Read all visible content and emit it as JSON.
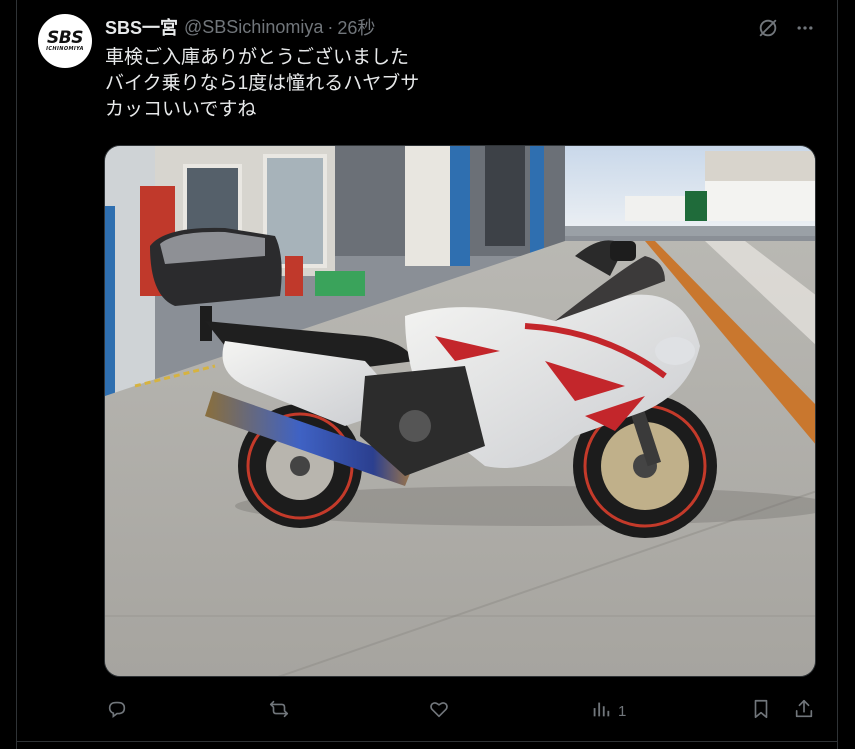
{
  "author": {
    "display_name": "SBS一宮",
    "handle": "@SBSichinomiya",
    "separator": "·",
    "timestamp": "26秒",
    "avatar_logo": "SBS",
    "avatar_logo_sub": "ICHINOMIYA"
  },
  "tweet": {
    "lines": [
      "車検ご入庫ありがとうございました",
      "バイク乗りなら1度は憧れるハヤブサ",
      "カッコいいですね"
    ]
  },
  "media": {
    "alt": "white and red sport motorcycle parked in an inspection garage"
  },
  "actions": {
    "views_count": "1"
  },
  "icons": {
    "grok": "grok-icon",
    "more": "more-icon",
    "reply": "reply-icon",
    "retweet": "retweet-icon",
    "like": "like-icon",
    "views": "views-icon",
    "bookmark": "bookmark-icon",
    "share": "share-icon"
  },
  "colors": {
    "background": "#000000",
    "text_primary": "#e7e9ea",
    "text_secondary": "#71767b",
    "border": "#2f3336"
  }
}
